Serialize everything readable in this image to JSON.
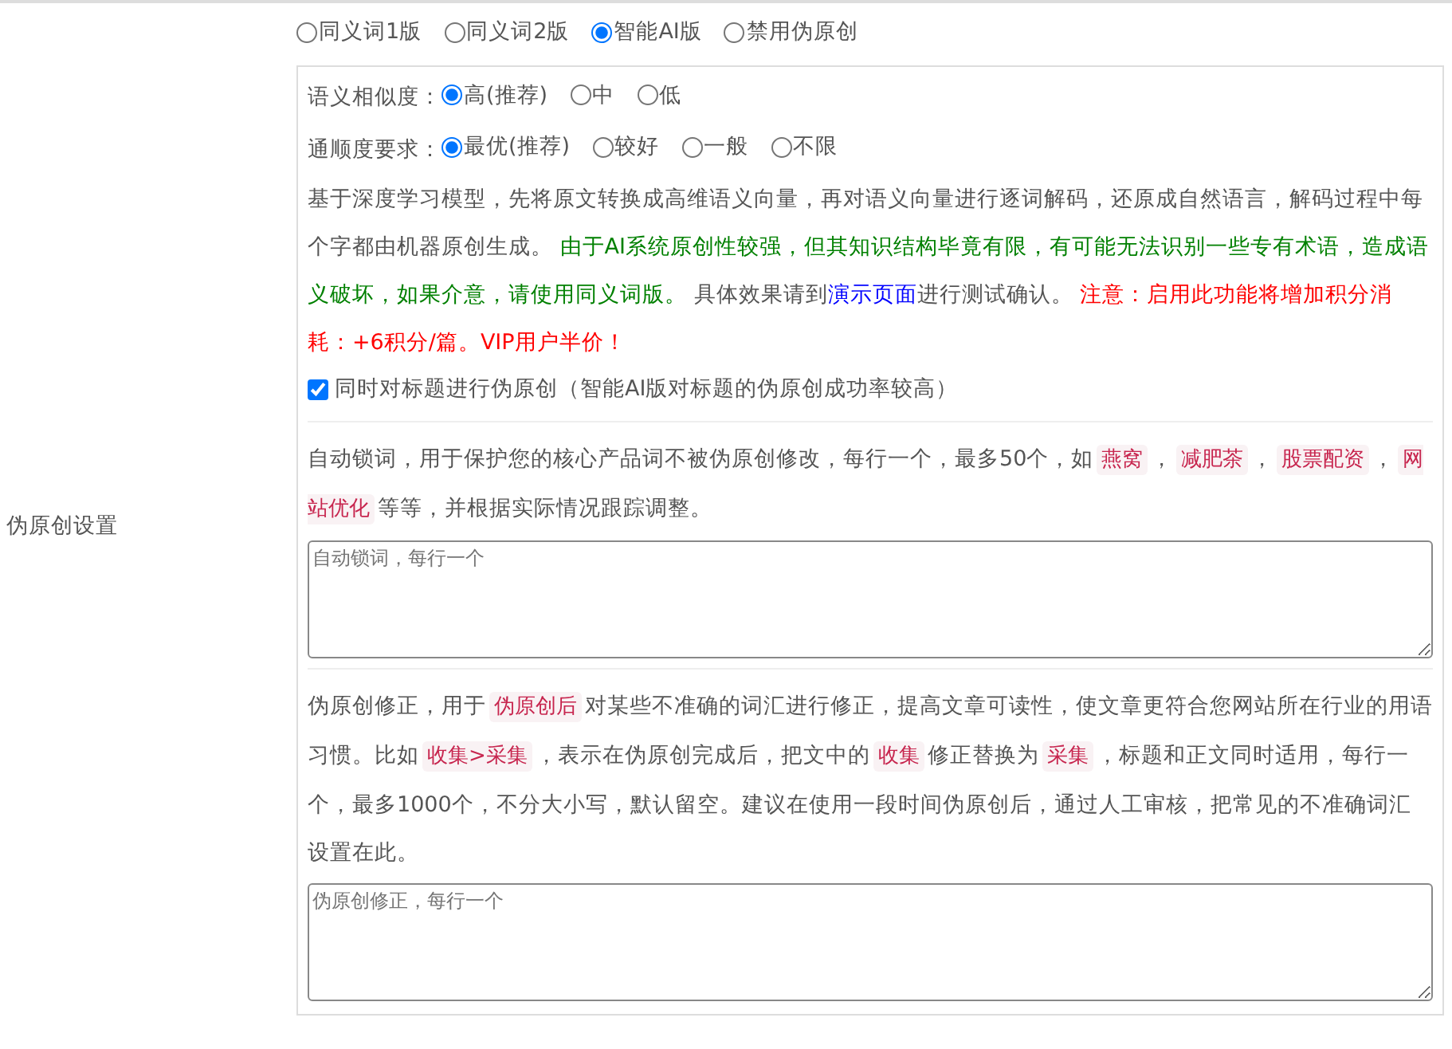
{
  "section_label": "伪原创设置",
  "mode_options": [
    {
      "label": "同义词1版",
      "selected": false
    },
    {
      "label": "同义词2版",
      "selected": false
    },
    {
      "label": "智能AI版",
      "selected": true
    },
    {
      "label": "禁用伪原创",
      "selected": false
    }
  ],
  "settings": [
    {
      "label": "语义相似度：",
      "options": [
        {
          "label": "高(推荐)",
          "selected": true
        },
        {
          "label": "中",
          "selected": false
        },
        {
          "label": "低",
          "selected": false
        }
      ]
    },
    {
      "label": "通顺度要求：",
      "options": [
        {
          "label": "最优(推荐)",
          "selected": true
        },
        {
          "label": "较好",
          "selected": false
        },
        {
          "label": "一般",
          "selected": false
        },
        {
          "label": "不限",
          "selected": false
        }
      ]
    }
  ],
  "ai_description": [
    {
      "kind": "plain",
      "text": "基于深度学习模型，先将原文转换成高维语义向量，再对语义向量进行逐词解码，还原成自然语言，解码过程中每个字都由机器原创生成。 "
    },
    {
      "kind": "warning",
      "text": "由于AI系统原创性较强，但其知识结构毕竟有限，有可能无法识别一些专有术语，造成语义破坏，如果介意，请使用同义词版。"
    },
    {
      "kind": "plain",
      "text": " 具体效果请到"
    },
    {
      "kind": "link",
      "text": "演示页面"
    },
    {
      "kind": "plain",
      "text": "进行测试确认。 "
    },
    {
      "kind": "alert",
      "text": "注意：启用此功能将增加积分消耗：+6积分/篇。VIP用户半价！"
    }
  ],
  "title_checkbox": {
    "label": "同时对标题进行伪原创（智能AI版对标题的伪原创成功率较高）",
    "checked": true
  },
  "lock_words": {
    "help": [
      {
        "kind": "text",
        "text": "自动锁词，用于保护您的核心产品词不被伪原创修改，每行一个，最多50个，如"
      },
      {
        "kind": "code",
        "text": "燕窝"
      },
      {
        "kind": "text",
        "text": "，"
      },
      {
        "kind": "code",
        "text": "减肥茶"
      },
      {
        "kind": "text",
        "text": "，"
      },
      {
        "kind": "code",
        "text": "股票配资"
      },
      {
        "kind": "text",
        "text": "，"
      },
      {
        "kind": "code",
        "text": "网站优化"
      },
      {
        "kind": "text",
        "text": "等等，并根据实际情况跟踪调整。"
      }
    ],
    "placeholder": "自动锁词，每行一个"
  },
  "corrections": {
    "help": [
      {
        "kind": "text",
        "text": "伪原创修正，用于"
      },
      {
        "kind": "code",
        "text": "伪原创后"
      },
      {
        "kind": "text",
        "text": "对某些不准确的词汇进行修正，提高文章可读性，使文章更符合您网站所在行业的用语习惯。比如"
      },
      {
        "kind": "code",
        "text": "收集>采集"
      },
      {
        "kind": "text",
        "text": "，表示在伪原创完成后，把文中的"
      },
      {
        "kind": "code",
        "text": "收集"
      },
      {
        "kind": "text",
        "text": "修正替换为"
      },
      {
        "kind": "code",
        "text": "采集"
      },
      {
        "kind": "text",
        "text": "，标题和正文同时适用，每行一个，最多1000个，不分大小写，默认留空。建议在使用一段时间伪原创后，通过人工审核，把常见的不准确词汇设置在此。"
      }
    ],
    "placeholder": "伪原创修正，每行一个"
  }
}
